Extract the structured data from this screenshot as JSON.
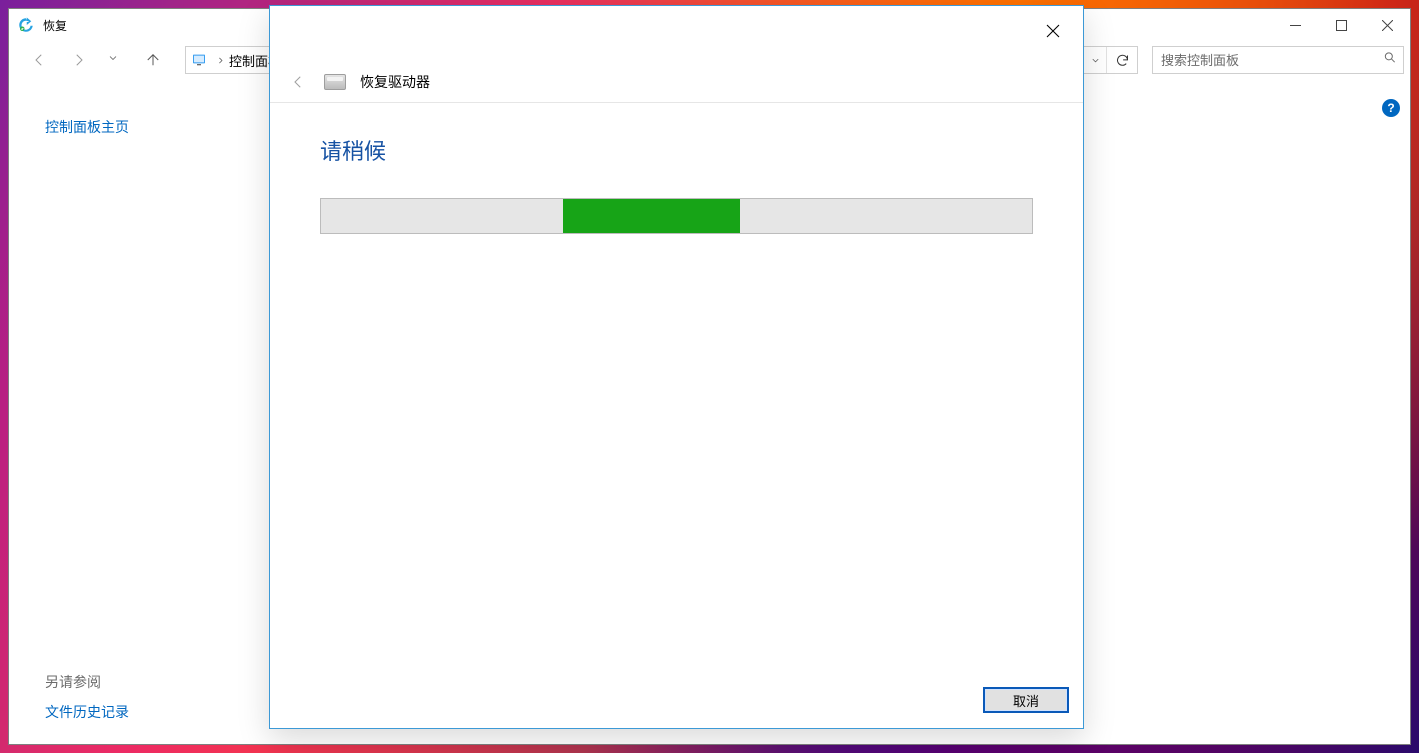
{
  "window": {
    "title": "恢复"
  },
  "nav": {
    "breadcrumb_control_panel": "控制面板"
  },
  "search": {
    "placeholder": "搜索控制面板"
  },
  "sidebar": {
    "home_label": "控制面板主页",
    "see_also_label": "另请参阅",
    "file_history_label": "文件历史记录"
  },
  "dialog": {
    "title": "恢复驱动器",
    "wait_label": "请稍候",
    "cancel_label": "取消",
    "progress": {
      "chunk_left_percent": 34,
      "chunk_width_percent": 25
    }
  },
  "help_tooltip": "?"
}
